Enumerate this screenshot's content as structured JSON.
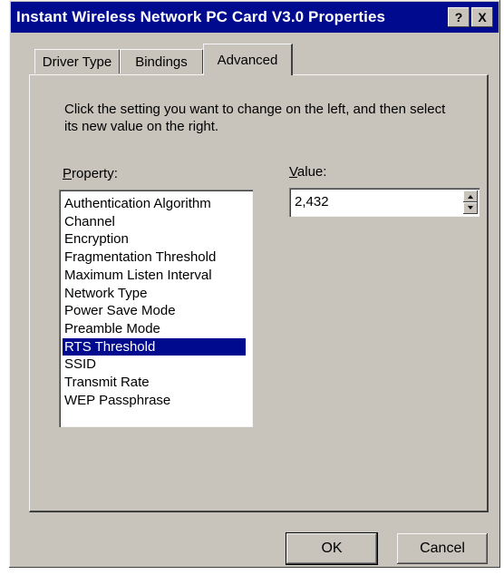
{
  "window": {
    "title": "Instant Wireless Network PC Card V3.0 Properties",
    "help_label": "?",
    "close_label": "X"
  },
  "tabs": [
    {
      "label": "Driver Type"
    },
    {
      "label": "Bindings"
    },
    {
      "label": "Advanced",
      "active": true
    }
  ],
  "panel": {
    "description": "Click the setting you want to change on the left, and then select its new value on the right.",
    "property_label": "Property:",
    "value_label": "Value:",
    "properties": [
      "Authentication Algorithm",
      "Channel",
      "Encryption",
      "Fragmentation Threshold",
      "Maximum Listen Interval",
      "Network Type",
      "Power Save Mode",
      "Preamble Mode",
      "RTS Threshold",
      "SSID",
      "Transmit Rate",
      "WEP Passphrase"
    ],
    "selected_property": "RTS Threshold",
    "value": "2,432"
  },
  "buttons": {
    "ok": "OK",
    "cancel": "Cancel"
  },
  "colors": {
    "titlebar": "#000a8e",
    "face": "#c8c4bc",
    "selection": "#000a8e"
  }
}
